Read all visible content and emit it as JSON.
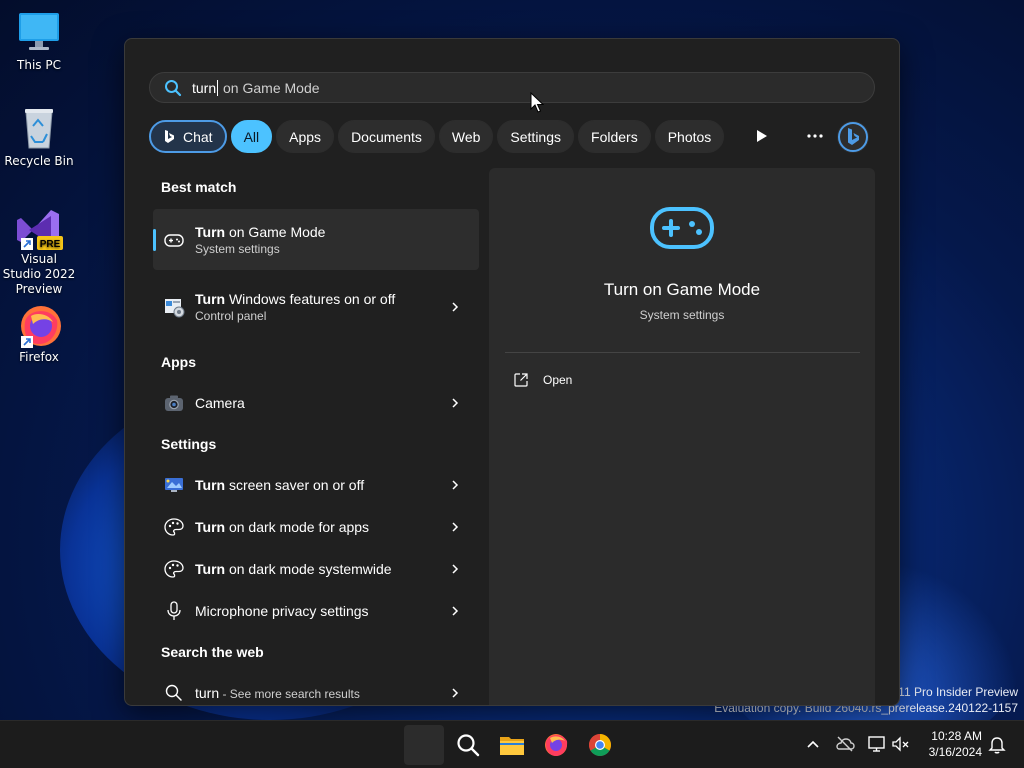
{
  "desktop": {
    "icons": [
      {
        "label": "This PC"
      },
      {
        "label": "Recycle Bin"
      },
      {
        "label": "Visual Studio 2022 Preview",
        "badge": "PRE"
      },
      {
        "label": "Firefox"
      }
    ],
    "watermark": {
      "line1": "s 11 Pro Insider Preview",
      "line2": "Evaluation copy. Build 26040.rs_prerelease.240122-1157"
    }
  },
  "search": {
    "typed": "turn",
    "suggestion": " on Game Mode"
  },
  "filters": {
    "chat": "Chat",
    "all": "All",
    "apps": "Apps",
    "documents": "Documents",
    "web": "Web",
    "settings": "Settings",
    "folders": "Folders",
    "photos": "Photos"
  },
  "sections": {
    "best_match": "Best match",
    "apps": "Apps",
    "settings": "Settings",
    "search_web": "Search the web"
  },
  "results": {
    "best": {
      "bold": "Turn",
      "rest": " on Game Mode",
      "sub": "System settings"
    },
    "features": {
      "bold": "Turn",
      "rest": " Windows features on or off",
      "sub": "Control panel"
    },
    "camera": {
      "label": "Camera"
    },
    "screensaver": {
      "bold": "Turn",
      "rest": " screen saver on or off"
    },
    "darkapps": {
      "bold": "Turn",
      "rest": " on dark mode for apps"
    },
    "darksystem": {
      "bold": "Turn",
      "rest": " on dark mode systemwide"
    },
    "mic": {
      "label": "Microphone privacy settings"
    },
    "web": {
      "term": "turn",
      "rest": " - See more search results"
    }
  },
  "preview": {
    "title": "Turn on Game Mode",
    "subtitle": "System settings",
    "open_label": "Open"
  },
  "taskbar": {
    "time": "10:28 AM",
    "date": "3/16/2024"
  },
  "colors": {
    "accent": "#4cc2ff",
    "panel": "#202020",
    "preview": "#2b2b2b"
  }
}
